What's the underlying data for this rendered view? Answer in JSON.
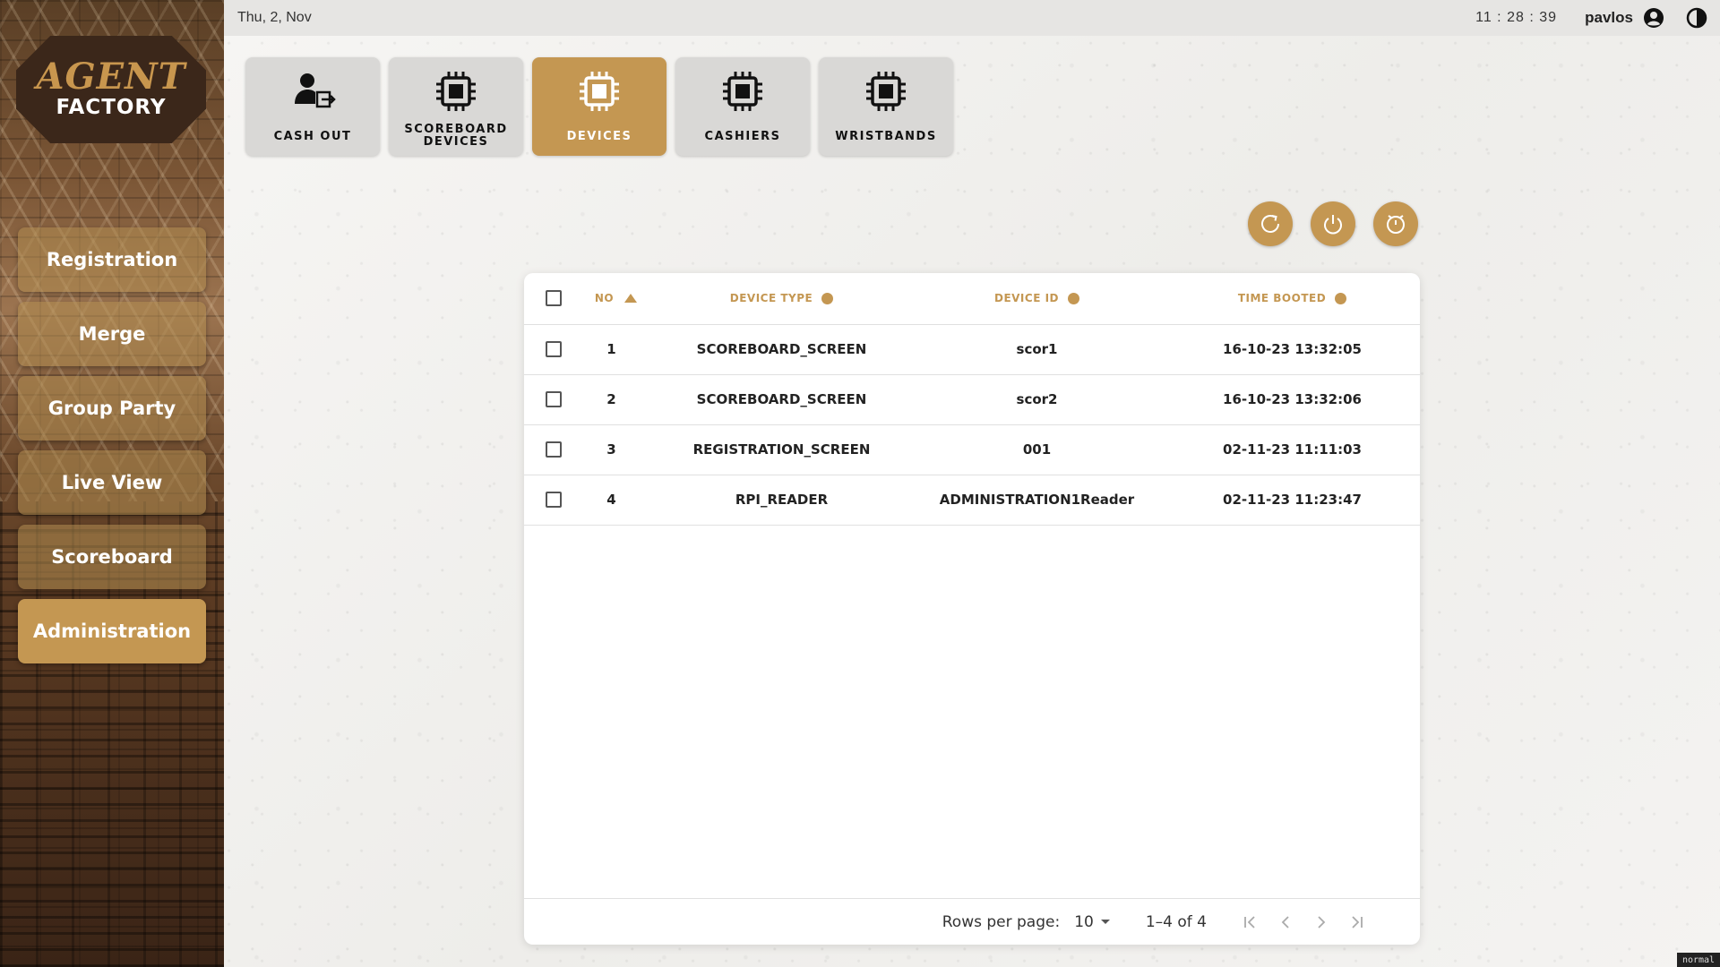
{
  "topbar": {
    "date": "Thu, 2, Nov",
    "time": "11 : 28 : 39",
    "user": "pavlos",
    "account_icon": "account-circle-icon",
    "theme_icon": "contrast-toggle-icon"
  },
  "logo": {
    "line1": "AGENT",
    "line2": "FACTORY"
  },
  "sidebar": {
    "items": [
      {
        "label": "Registration",
        "active": false
      },
      {
        "label": "Merge",
        "active": false
      },
      {
        "label": "Group Party",
        "active": false
      },
      {
        "label": "Live View",
        "active": false
      },
      {
        "label": "Scoreboard",
        "active": false
      },
      {
        "label": "Administration",
        "active": true
      }
    ]
  },
  "tabs": [
    {
      "label": "CASH  OUT",
      "icon": "user-exit-icon",
      "active": false
    },
    {
      "label": "SCOREBOARD\nDEVICES",
      "icon": "chip-icon",
      "active": false
    },
    {
      "label": "DEVICES",
      "icon": "chip-icon",
      "active": true
    },
    {
      "label": "CASHIERS",
      "icon": "chip-icon",
      "active": false
    },
    {
      "label": "WRISTBANDS",
      "icon": "chip-icon",
      "active": false
    }
  ],
  "actions": [
    {
      "name": "refresh",
      "icon": "refresh-icon"
    },
    {
      "name": "power",
      "icon": "power-icon"
    },
    {
      "name": "timer",
      "icon": "stopwatch-icon"
    }
  ],
  "table": {
    "columns": [
      "NO",
      "DEVICE TYPE",
      "DEVICE ID",
      "TIME BOOTED"
    ],
    "rows": [
      {
        "no": "1",
        "type": "SCOREBOARD_SCREEN",
        "id": "scor1",
        "booted": "16-10-23 13:32:05"
      },
      {
        "no": "2",
        "type": "SCOREBOARD_SCREEN",
        "id": "scor2",
        "booted": "16-10-23 13:32:06"
      },
      {
        "no": "3",
        "type": "REGISTRATION_SCREEN",
        "id": "001",
        "booted": "02-11-23 11:11:03"
      },
      {
        "no": "4",
        "type": "RPI_READER",
        "id": "ADMINISTRATION1Reader",
        "booted": "02-11-23 11:23:47"
      }
    ]
  },
  "pager": {
    "rows_per_page_label": "Rows per page:",
    "rows_per_page": "10",
    "range": "1–4 of 4"
  },
  "mode_badge": "normal",
  "colors": {
    "accent": "#c49752",
    "tab_bg": "#d9d8d6",
    "topbar_bg": "#e6e5e3"
  }
}
